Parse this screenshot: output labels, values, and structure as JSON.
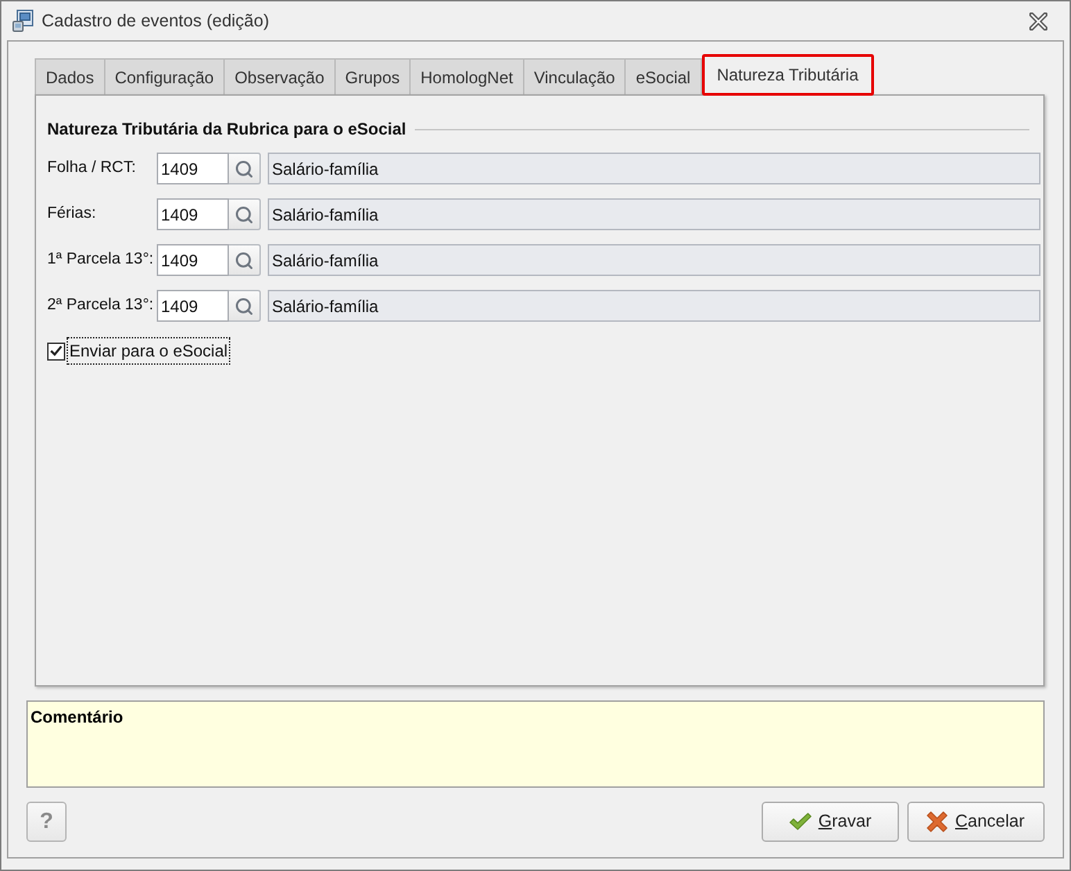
{
  "window": {
    "title": "Cadastro de eventos (edição)"
  },
  "tabs": [
    {
      "label": "Dados",
      "selected": false
    },
    {
      "label": "Configuração",
      "selected": false
    },
    {
      "label": "Observação",
      "selected": false
    },
    {
      "label": "Grupos",
      "selected": false
    },
    {
      "label": "HomologNet",
      "selected": false
    },
    {
      "label": "Vinculação",
      "selected": false
    },
    {
      "label": "eSocial",
      "selected": false
    },
    {
      "label": "Natureza Tributária",
      "selected": true
    }
  ],
  "group": {
    "title": "Natureza Tributária da Rubrica para o eSocial",
    "rows": [
      {
        "label": "Folha / RCT:",
        "code": "1409",
        "description": "Salário-família"
      },
      {
        "label": "Férias:",
        "code": "1409",
        "description": "Salário-família"
      },
      {
        "label": "1ª Parcela 13°:",
        "code": "1409",
        "description": "Salário-família"
      },
      {
        "label": "2ª Parcela 13°:",
        "code": "1409",
        "description": "Salário-família"
      }
    ],
    "checkbox": {
      "label": "Enviar para o eSocial",
      "checked": true,
      "focused": true
    }
  },
  "comment": {
    "label": "Comentário"
  },
  "buttons": [
    {
      "kind": "help",
      "label": "?"
    },
    {
      "kind": "save",
      "label": "Gravar",
      "shortcut_underlined": true
    },
    {
      "kind": "cancel",
      "label": "Cancelar",
      "shortcut_underlined": true
    }
  ]
}
